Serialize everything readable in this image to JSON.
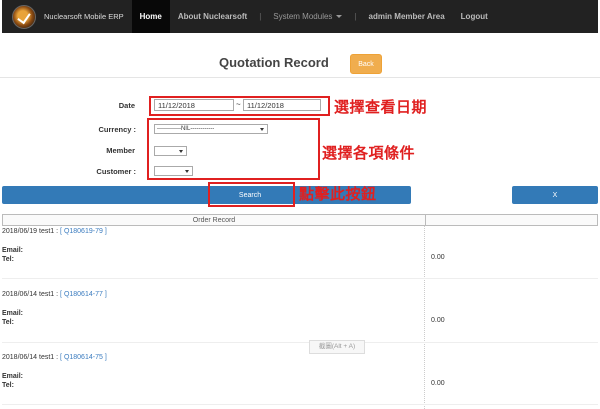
{
  "nav": {
    "brand": "Nuclearsoft Mobile ERP",
    "home": "Home",
    "about": "About Nuclearsoft",
    "sep1": "|",
    "system_modules": "System Modules",
    "sep2": "|",
    "member_area": "admin Member Area",
    "logout": "Logout"
  },
  "page": {
    "title": "Quotation Record",
    "back_label": "Back"
  },
  "filters": {
    "date_label": "Date",
    "date_from": "11/12/2018",
    "date_sep": "~",
    "date_to": "11/12/2018",
    "currency_label": "Currency :",
    "currency_value": "------------NIL------------",
    "member_label": "Member",
    "member_value": "",
    "customer_label": "Customer :",
    "customer_value": ""
  },
  "annotations": {
    "date_note": "選擇查看日期",
    "conditions_note": "選擇各項條件",
    "search_note": "點擊此按鈕"
  },
  "actions": {
    "search_label": "Search",
    "close_label": "X"
  },
  "table": {
    "header": "Order Record",
    "records": [
      {
        "date": "2018/06/19",
        "user": "test1 :",
        "code_open": "[",
        "code": "Q180619-79",
        "code_close": "]",
        "email": "Email:",
        "tel": "Tel:",
        "amount": "0.00"
      },
      {
        "date": "2018/06/14",
        "user": "test1 :",
        "code_open": "[",
        "code": "Q180614-77",
        "code_close": "]",
        "email": "Email:",
        "tel": "Tel:",
        "amount": "0.00"
      },
      {
        "date": "2018/06/14",
        "user": "test1 :",
        "code_open": "[",
        "code": "Q180614-75",
        "code_close": "]",
        "email": "Email:",
        "tel": "Tel:",
        "amount": "0.00"
      }
    ]
  },
  "tooltip": "截圖(Alt + A)",
  "colors": {
    "navbar": "#222222",
    "primary": "#337ab7",
    "warning": "#f0ad4e",
    "annotation": "#e02020"
  }
}
